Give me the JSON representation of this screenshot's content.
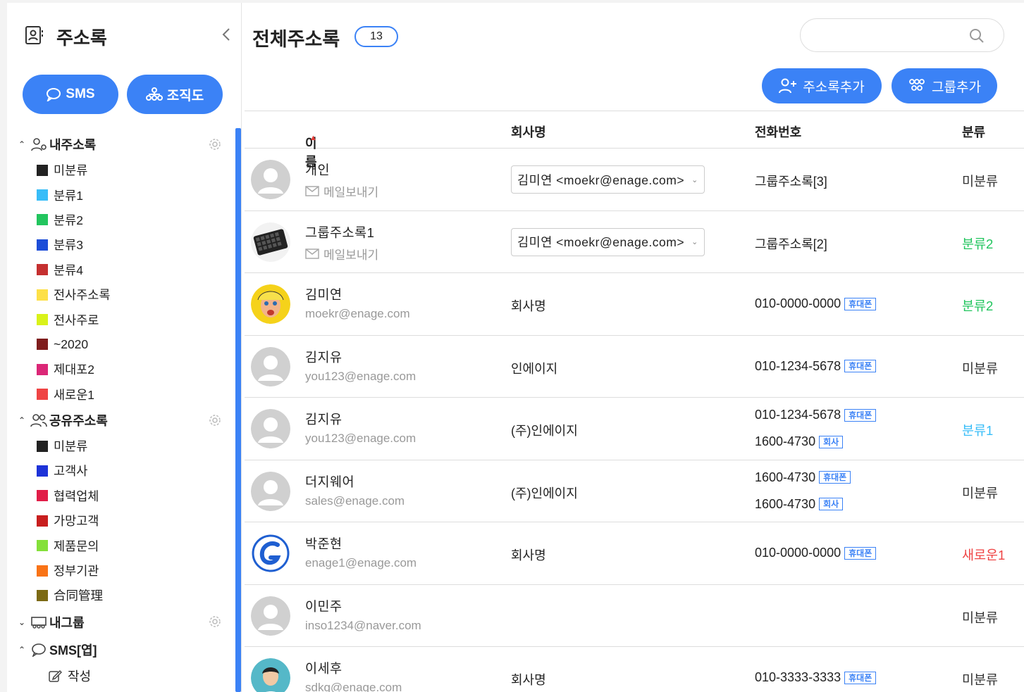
{
  "sidebar": {
    "title": "주소록",
    "sms_button": "SMS",
    "org_button": "조직도",
    "my_addressbook": {
      "label": "내주소록",
      "categories": [
        {
          "label": "미분류",
          "color": "#222222"
        },
        {
          "label": "분류1",
          "color": "#38bdf8"
        },
        {
          "label": "분류2",
          "color": "#22c55e"
        },
        {
          "label": "분류3",
          "color": "#1d4ed8"
        },
        {
          "label": "분류4",
          "color": "#c53030"
        },
        {
          "label": "전사주소록",
          "color": "#fde047"
        },
        {
          "label": "전사주로",
          "color": "#d9f21a"
        },
        {
          "label": "~2020",
          "color": "#7f1d1d"
        },
        {
          "label": "제대포2",
          "color": "#db2777"
        },
        {
          "label": "새로운1",
          "color": "#ef4444"
        }
      ]
    },
    "shared_addressbook": {
      "label": "공유주소록",
      "categories": [
        {
          "label": "미분류",
          "color": "#222222"
        },
        {
          "label": "고객사",
          "color": "#1d33d8"
        },
        {
          "label": "협력업체",
          "color": "#e11d48"
        },
        {
          "label": "가망고객",
          "color": "#c81e1e"
        },
        {
          "label": "제품문의",
          "color": "#84e03a"
        },
        {
          "label": "정부기관",
          "color": "#f97316"
        },
        {
          "label": "合同管理",
          "color": "#7c6a14"
        }
      ]
    },
    "my_group": {
      "label": "내그룹"
    },
    "sms_group": {
      "label": "SMS[엽]",
      "write": "작성"
    }
  },
  "main": {
    "title": "전체주소록",
    "count": "13",
    "search": {
      "placeholder": ""
    },
    "add_contact_button": "주소록추가",
    "add_group_button": "그룹추가",
    "columns": {
      "name": "이름",
      "company": "회사명",
      "phone": "전화번호",
      "category": "분류"
    }
  },
  "rows": [
    {
      "name": "개인",
      "sub": "메일보내기",
      "sender": "김미연 <moekr@enage.com>",
      "group": "그룹주소록[3]",
      "category": "미분류",
      "category_color": "#333333"
    },
    {
      "name": "그룹주소록1",
      "sub": "메일보내기",
      "sender": "김미연 <moekr@enage.com>",
      "group": "그룹주소록[2]",
      "category": "분류2",
      "category_color": "#22c55e"
    },
    {
      "name": "김미연",
      "sub": "moekr@enage.com",
      "company": "회사명",
      "phone1": "010-0000-0000",
      "tag1": "휴대폰",
      "category": "분류2",
      "category_color": "#22c55e"
    },
    {
      "name": "김지유",
      "sub": "you123@enage.com",
      "company": "인에이지",
      "phone1": "010-1234-5678",
      "tag1": "휴대폰",
      "category": "미분류",
      "category_color": "#333333"
    },
    {
      "name": "김지유",
      "sub": "you123@enage.com",
      "company": "(주)인에이지",
      "phone1": "010-1234-5678",
      "tag1": "휴대폰",
      "phone2": "1600-4730",
      "tag2": "회사",
      "category": "분류1",
      "category_color": "#38bdf8"
    },
    {
      "name": "더지웨어",
      "sub": "sales@enage.com",
      "company": "(주)인에이지",
      "phone1": "1600-4730",
      "tag1": "휴대폰",
      "phone2": "1600-4730",
      "tag2": "회사",
      "category": "미분류",
      "category_color": "#333333"
    },
    {
      "name": "박준현",
      "sub": "enage1@enage.com",
      "company": "회사명",
      "phone1": "010-0000-0000",
      "tag1": "휴대폰",
      "category": "새로운1",
      "category_color": "#ef4444"
    },
    {
      "name": "이민주",
      "sub": "inso1234@naver.com",
      "category": "미분류",
      "category_color": "#333333"
    },
    {
      "name": "이세후",
      "sub": "sdkg@enage.com",
      "company": "회사명",
      "phone1": "010-3333-3333",
      "tag1": "휴대폰",
      "category": "미분류",
      "category_color": "#333333"
    }
  ]
}
